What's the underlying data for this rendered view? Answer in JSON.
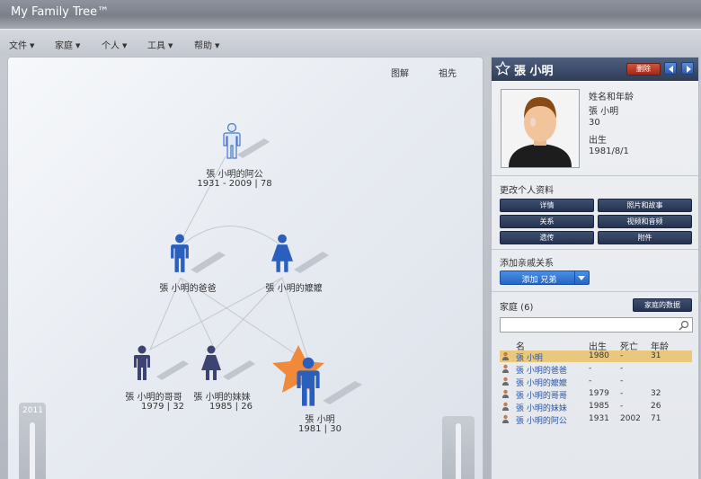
{
  "app": {
    "title": "My Family Tree™"
  },
  "menu": [
    {
      "label": "文件"
    },
    {
      "label": "家庭"
    },
    {
      "label": "个人"
    },
    {
      "label": "工具"
    },
    {
      "label": "帮助"
    }
  ],
  "tree_panel": {
    "legend_link": "图解",
    "ancestors_link": "祖先",
    "year_badge": "2011",
    "people": [
      {
        "id": "grandpa",
        "name": "張 小明的阿公",
        "dates": "1931 - 2009 | 78",
        "gender": "male",
        "style": "outline"
      },
      {
        "id": "father",
        "name": "張 小明的爸爸",
        "dates": "",
        "gender": "male",
        "style": "filled"
      },
      {
        "id": "mother",
        "name": "張 小明的嬤嬤",
        "dates": "",
        "gender": "female",
        "style": "filled"
      },
      {
        "id": "brother",
        "name": "張 小明的哥哥",
        "dates": "1979 | 32",
        "gender": "male",
        "style": "dark"
      },
      {
        "id": "sister",
        "name": "張 小明的妹妹",
        "dates": "1985 | 26",
        "gender": "female",
        "style": "dark"
      },
      {
        "id": "self",
        "name": "張 小明",
        "dates": "1981 | 30",
        "gender": "male",
        "style": "star"
      }
    ]
  },
  "detail": {
    "name": "張 小明",
    "delete_label": "删除",
    "info": {
      "name_age_label": "姓名和年龄",
      "name_value": "張 小明",
      "age_value": "30",
      "birth_label": "出生",
      "birth_value": "1981/8/1"
    },
    "edit_section_title": "更改个人资料",
    "edit_buttons": [
      "详情",
      "照片和故事",
      "关系",
      "视频和音频",
      "遗传",
      "附件"
    ],
    "add_relation_title": "添加亲戚关系",
    "add_relation_value": "添加 兄弟",
    "family_title": "家庭 (6)",
    "family_button": "家庭的数据",
    "search_placeholder": "",
    "columns": [
      "名",
      "出生",
      "死亡",
      "年龄"
    ],
    "rows": [
      {
        "name": "張 小明",
        "born": "1980",
        "died": "-",
        "age": "31",
        "selected": true
      },
      {
        "name": "張 小明的爸爸",
        "born": "-",
        "died": "-",
        "age": "",
        "selected": false
      },
      {
        "name": "張 小明的嬤嬤",
        "born": "-",
        "died": "-",
        "age": "",
        "selected": false
      },
      {
        "name": "張 小明的哥哥",
        "born": "1979",
        "died": "-",
        "age": "32",
        "selected": false
      },
      {
        "name": "張 小明的妹妹",
        "born": "1985",
        "died": "-",
        "age": "26",
        "selected": false
      },
      {
        "name": "張 小明的阿公",
        "born": "1931",
        "died": "2002",
        "age": "71",
        "selected": false
      }
    ]
  },
  "colors": {
    "header_dark": "#2f3d58",
    "person_blue": "#2a5fbd",
    "person_dark": "#3d4471",
    "star_orange": "#f08a3a",
    "selected_row": "#e9c87c"
  }
}
